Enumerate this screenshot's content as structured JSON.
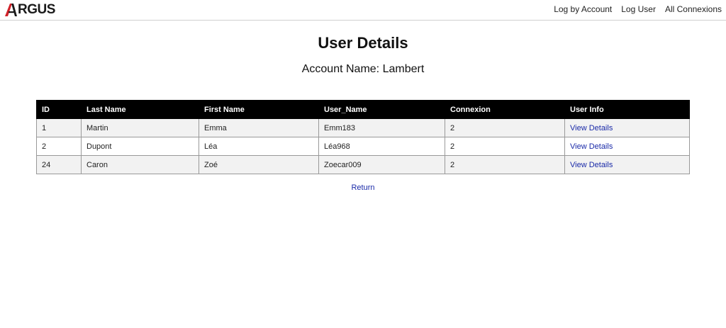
{
  "header": {
    "logo_text": "RGUS",
    "logo_brand": "ARGUS",
    "logo_accent": "#d1232a",
    "nav": [
      {
        "label": "Log by Account"
      },
      {
        "label": "Log User"
      },
      {
        "label": "All Connexions"
      }
    ]
  },
  "main": {
    "title": "User Details",
    "account_label": "Account Name: Lambert"
  },
  "table": {
    "columns": [
      "ID",
      "Last Name",
      "First Name",
      "User_Name",
      "Connexion",
      "User Info"
    ],
    "rows": [
      {
        "id": "1",
        "last_name": "Martin",
        "first_name": "Emma",
        "user_name": "Emm183",
        "connexion": "2",
        "info_link": "View Details"
      },
      {
        "id": "2",
        "last_name": "Dupont",
        "first_name": "Léa",
        "user_name": "Léa968",
        "connexion": "2",
        "info_link": "View Details"
      },
      {
        "id": "24",
        "last_name": "Caron",
        "first_name": "Zoé",
        "user_name": "Zoecar009",
        "connexion": "2",
        "info_link": "View Details"
      }
    ]
  },
  "footer": {
    "return_label": "Return"
  },
  "colors": {
    "header_bg": "#000000",
    "link": "#1a2aa8",
    "row_alt": "#f2f2f2"
  }
}
